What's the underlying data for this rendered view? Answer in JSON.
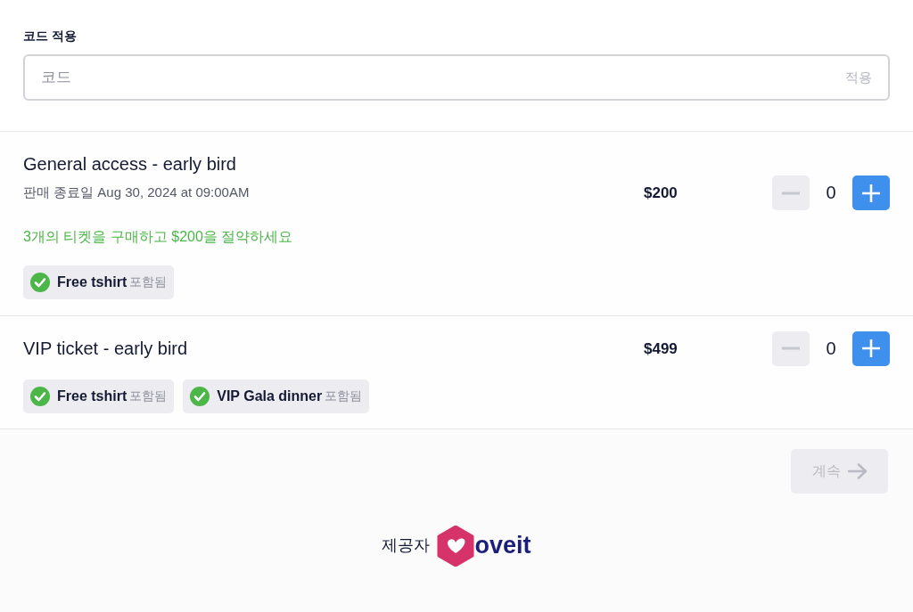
{
  "promo": {
    "label": "코드 적용",
    "placeholder": "코드",
    "apply": "적용"
  },
  "tickets": [
    {
      "name": "General access - early bird",
      "sale_end": "판매 종료일 Aug 30, 2024 at 09:00AM",
      "offer": "3개의 티켓을 구매하고 $200을 절약하세요",
      "price": "$200",
      "quantity": "0",
      "decrement_disabled": true,
      "perks": [
        {
          "name": "Free tshirt",
          "note": "포함됨"
        }
      ]
    },
    {
      "name": "VIP ticket - early bird",
      "price": "$499",
      "quantity": "0",
      "decrement_disabled": true,
      "perks": [
        {
          "name": "Free tshirt",
          "note": "포함됨"
        },
        {
          "name": "VIP Gala dinner",
          "note": "포함됨"
        }
      ]
    }
  ],
  "continue_button": {
    "label": "계속",
    "disabled": true
  },
  "footer": {
    "prefix": "제공자",
    "brand": "oveit"
  }
}
